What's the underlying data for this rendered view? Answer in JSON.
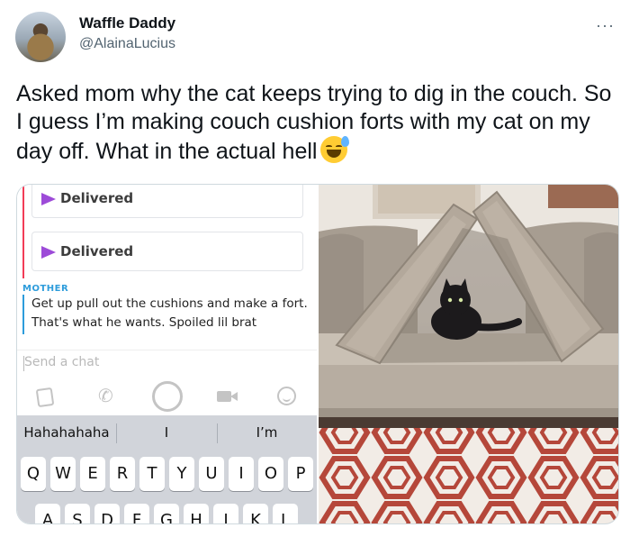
{
  "tweet": {
    "display_name": "Waffle Daddy",
    "handle": "@AlainaLucius",
    "more_label": "···",
    "text": "Asked mom why the cat keeps trying to dig in the couch. So I guess I’m making couch cushion forts with my cat on my day off. What in the actual hell",
    "emoji": "grinning-face-with-sweat"
  },
  "chat": {
    "delivered_1": "Delivered",
    "delivered_2": "Delivered",
    "sender": "MOTHER",
    "message": "Get up pull out the cushions and make a fort. That's what he wants.  Spoiled lil brat",
    "input_placeholder": "Send a chat",
    "toolbar_icons": [
      "sticker-icon",
      "phone-icon",
      "capture-button-icon",
      "video-icon",
      "smiley-icon"
    ]
  },
  "keyboard": {
    "suggestions": [
      "Hahahahaha",
      "I",
      "I’m"
    ],
    "row1": [
      "Q",
      "W",
      "E",
      "R",
      "T",
      "Y",
      "U",
      "I",
      "O",
      "P"
    ],
    "row2": [
      "A",
      "S",
      "D",
      "F",
      "G",
      "H",
      "J",
      "K",
      "L"
    ]
  },
  "colors": {
    "delivered_arrow": "#9d4bd8",
    "mother_label": "#2d9cdb",
    "chat_red_line": "#f23c57",
    "handle": "#536471"
  }
}
